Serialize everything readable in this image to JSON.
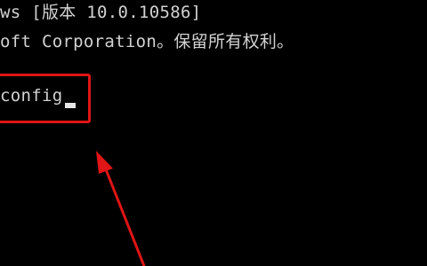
{
  "console": {
    "lines": [
      "ws [版本 10.0.10586]",
      "oft Corporation。保留所有权利。",
      "config"
    ]
  },
  "colors": {
    "background": "#000000",
    "text": "#d2d2d2",
    "annotation": "#e01515"
  },
  "icons": {
    "cursor": "text-cursor-icon",
    "arrow": "arrow-up-left-icon"
  }
}
